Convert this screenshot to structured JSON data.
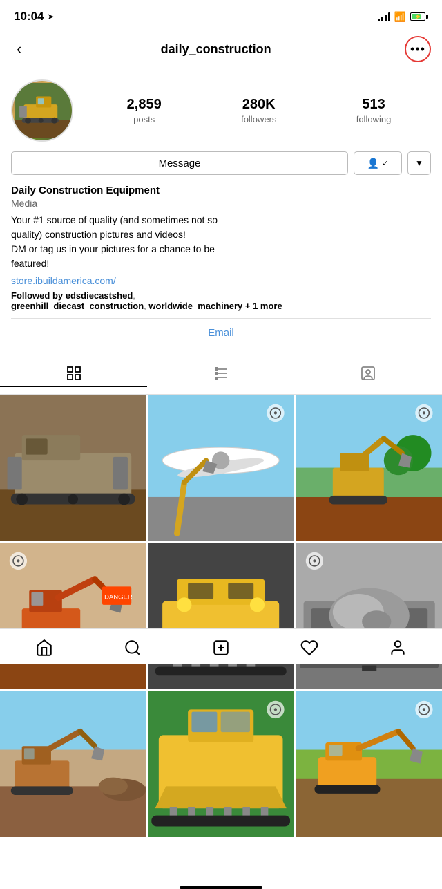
{
  "status_bar": {
    "time": "10:04",
    "location_icon": "location-arrow"
  },
  "nav": {
    "back_label": "‹",
    "title": "daily_construction",
    "more_icon": "ellipsis"
  },
  "profile": {
    "stats": {
      "posts_count": "2,859",
      "posts_label": "posts",
      "followers_count": "280K",
      "followers_label": "followers",
      "following_count": "513",
      "following_label": "following"
    },
    "buttons": {
      "message": "Message",
      "follow_icon": "person-checkmark",
      "dropdown_icon": "chevron-down"
    },
    "display_name": "Daily Construction Equipment",
    "category": "Media",
    "bio_line1": "Your #1 source of quality (and sometimes not so",
    "bio_line2": "quality) construction pictures and videos!",
    "bio_line3": "DM or tag us in your pictures for a chance to be",
    "bio_line4": "featured!",
    "link": "store.ibuildamerica.com/",
    "followed_by_prefix": "Followed by ",
    "followed_by_users": "edsdiecastshed",
    "followed_by_users2": "greenhill_diecast_construction",
    "followed_by_users3": "worldwide_machinery",
    "followed_by_more": "+ 1",
    "followed_by_more_text": "more"
  },
  "email_section": {
    "label": "Email"
  },
  "tabs": {
    "grid_icon": "grid",
    "list_icon": "list",
    "tag_icon": "person-tag"
  },
  "photos": [
    {
      "id": 1,
      "has_reel": false
    },
    {
      "id": 2,
      "has_reel": true
    },
    {
      "id": 3,
      "has_reel": true
    },
    {
      "id": 4,
      "has_reel": true
    },
    {
      "id": 5,
      "has_reel": false
    },
    {
      "id": 6,
      "has_reel": true
    },
    {
      "id": 7,
      "has_reel": false
    },
    {
      "id": 8,
      "has_reel": true
    },
    {
      "id": 9,
      "has_reel": true
    }
  ],
  "bottom_nav": {
    "home_icon": "home",
    "search_icon": "search",
    "add_icon": "plus-square",
    "heart_icon": "heart",
    "profile_icon": "person"
  }
}
